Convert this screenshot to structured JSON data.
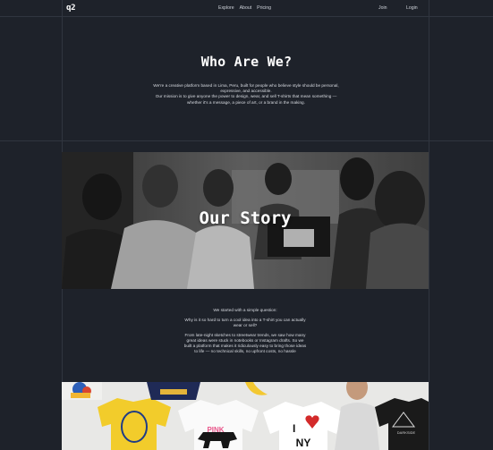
{
  "nav": {
    "logo": "q2",
    "links": [
      "Explore",
      "About",
      "Pricing"
    ],
    "join": "Join",
    "login": "Login"
  },
  "hero": {
    "title": "Who Are We?",
    "paragraph1": "We're a creative platform based in Lima, Peru, built for people who believe style should be personal, expressive, and accessible.",
    "paragraph2": "Our mission is to give anyone the power to design, wear, and sell T-shirts that mean something — whether it's a message, a piece of art, or a brand in the making."
  },
  "story": {
    "title": "Our Story",
    "p1": "We started with a simple question:",
    "p2": "Why is it so hard to turn a cool idea into a T-shirt you can actually wear or sell?",
    "p3": "From late-night sketches to streetwear trends, we saw how many great ideas were stuck in notebooks or Instagram drafts. So we built a platform that makes it ridiculously easy to bring those ideas to life — no technical skills, no upfront costs, no hassle"
  },
  "gallery": {
    "shirt_texts": [
      "PINK",
      "I",
      "NY",
      "DARKSIDE"
    ]
  },
  "colors": {
    "background": "#1e222a",
    "grid_line": "#30353f",
    "text": "#d7dae0",
    "heading": "#ffffff"
  }
}
